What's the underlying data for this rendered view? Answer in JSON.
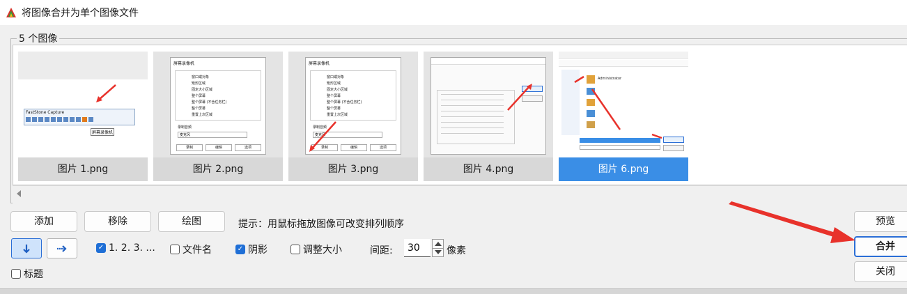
{
  "window": {
    "title": "将图像合并为单个图像文件",
    "group_label": "5 个图像"
  },
  "thumbnails": [
    {
      "caption": "图片 1.png",
      "selected": false
    },
    {
      "caption": "图片 2.png",
      "selected": false
    },
    {
      "caption": "图片 3.png",
      "selected": false
    },
    {
      "caption": "图片 4.png",
      "selected": false
    },
    {
      "caption": "图片 6.png",
      "selected": true
    }
  ],
  "buttons": {
    "add": "添加",
    "remove": "移除",
    "draw": "绘图",
    "preview": "预览",
    "merge": "合并",
    "close": "关闭"
  },
  "hint": "提示：用鼠标拖放图像可改变排列顺序",
  "options": {
    "numbering": {
      "label": "1. 2. 3. ...",
      "checked": true
    },
    "filename": {
      "label": "文件名",
      "checked": false
    },
    "shadow": {
      "label": "阴影",
      "checked": true
    },
    "resize": {
      "label": "调整大小",
      "checked": false
    },
    "caption": {
      "label": "标题",
      "checked": false
    }
  },
  "spacing": {
    "label": "间距:",
    "value": "30",
    "unit": "像素"
  },
  "direction": {
    "vertical_icon": "arrow-down-icon",
    "horizontal_icon": "arrow-right-icon",
    "selected": "vertical"
  },
  "thumb_content": {
    "capture_title": "FastStone Capture",
    "capture_tooltip": "屏幕录像机",
    "recorder_title": "屏幕录像机",
    "recorder_items": [
      "窗口或对象",
      "矩形区域",
      "固定大小区域",
      "整个屏幕",
      "整个屏幕 (不含任务栏)",
      "整个屏幕",
      "重置上次区域"
    ],
    "recorder_audio": "录制音频",
    "recorder_device": "麦克风",
    "recorder_btns": [
      "录制",
      "编辑",
      "选项"
    ],
    "admin": "Administrator"
  },
  "colors": {
    "accent": "#3a8ee6",
    "annotation_red": "#e8322b"
  }
}
